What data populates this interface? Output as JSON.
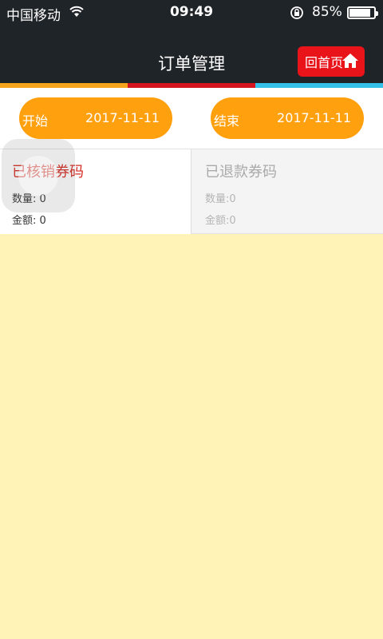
{
  "status_bar": {
    "carrier": "中国移动",
    "time": "09:49",
    "battery_percent": "85%",
    "battery_level": 0.85
  },
  "nav": {
    "title": "订单管理",
    "home_label": "回首页",
    "home_icon": "home-icon"
  },
  "filter": {
    "start_label": "开始",
    "start_date": "2017-11-11",
    "end_label": "结束",
    "end_date": "2017-11-11"
  },
  "cards": {
    "verified": {
      "title": "已核销券码",
      "count": "数量: 0",
      "amount": "金额: 0"
    },
    "refunded": {
      "title": "已退款券码",
      "count": "数量:0",
      "amount": "金额:0"
    }
  },
  "colors": {
    "header_bg": "#1f2428",
    "accent_orange": "#ffa00f",
    "accent_red": "#e9131a",
    "accent_cyan": "#33c1e9",
    "page_bg": "#fff3b8"
  }
}
